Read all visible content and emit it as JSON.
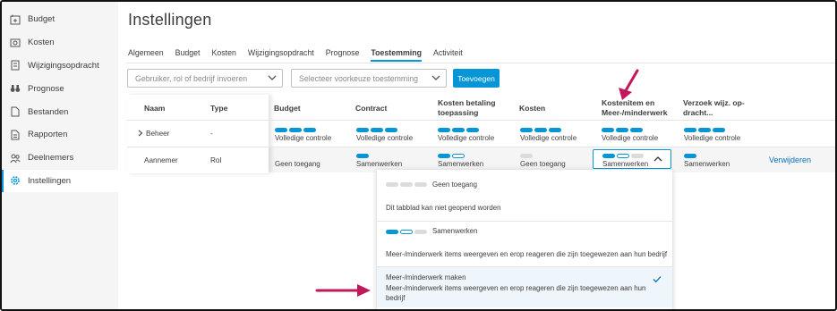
{
  "sidebar": {
    "items": [
      {
        "label": "Budget",
        "icon": "budget-icon"
      },
      {
        "label": "Kosten",
        "icon": "cost-icon"
      },
      {
        "label": "Wijzigingsopdracht",
        "icon": "change-order-icon"
      },
      {
        "label": "Prognose",
        "icon": "binoculars-icon"
      },
      {
        "label": "Bestanden",
        "icon": "file-icon"
      },
      {
        "label": "Rapporten",
        "icon": "report-icon"
      },
      {
        "label": "Deelnemers",
        "icon": "people-icon"
      },
      {
        "label": "Instellingen",
        "icon": "gear-icon"
      }
    ],
    "active_index": 7
  },
  "header": {
    "title": "Instellingen"
  },
  "tabs": {
    "items": [
      "Algemeen",
      "Budget",
      "Kosten",
      "Wijzigingsopdracht",
      "Prognose",
      "Toestemming",
      "Activiteit"
    ],
    "active": "Toestemming"
  },
  "filters": {
    "user_placeholder": "Gebruiker, rol of bedrijf invoeren",
    "preset_placeholder": "Selecteer voorkeuze toestemming",
    "add_label": "Toevoegen"
  },
  "table": {
    "headers": {
      "name": "Naam",
      "type": "Type",
      "budget": "Budget",
      "contract": "Contract",
      "cost_payment_line1": "Kosten betaling",
      "cost_payment_line2": "toepassing",
      "costs": "Kosten",
      "cost_item_line1": "Kostenitem en",
      "cost_item_line2": "Meer-/minderwerk",
      "change_request_line1": "Verzoek wijz. op-",
      "change_request_line2": "dracht..."
    },
    "rows": [
      {
        "name": "Beheer",
        "type": "-",
        "cells": [
          "Volledige controle",
          "Volledige controle",
          "Volledige controle",
          "Volledige controle",
          "Volledige controle",
          "Volledige controle"
        ]
      },
      {
        "name": "Aannemer",
        "type": "Rol",
        "cells": [
          "Geen toegang",
          "Samenwerken",
          "Samenwerken",
          "Geen toegang",
          "Samenwerken",
          "Samenwerken"
        ],
        "action": "Verwijderen"
      }
    ]
  },
  "dropdown": {
    "options": [
      {
        "title": "Geen toegang",
        "description": "Dit tabblad kan niet geopend worden"
      },
      {
        "title": "Samenwerken",
        "description": "Meer-/minderwerk items weergeven en erop reageren die zijn toegewezen aan hun bedrijf"
      },
      {
        "title": "Meer-/minderwerk maken",
        "description_line1": "Meer-/minderwerk items weergeven en erop reageren die zijn toegewezen aan hun",
        "description_line2": "bedrijf",
        "selected": true
      }
    ]
  },
  "colors": {
    "accent": "#0696d7",
    "annotation_arrow": "#c2185b"
  }
}
